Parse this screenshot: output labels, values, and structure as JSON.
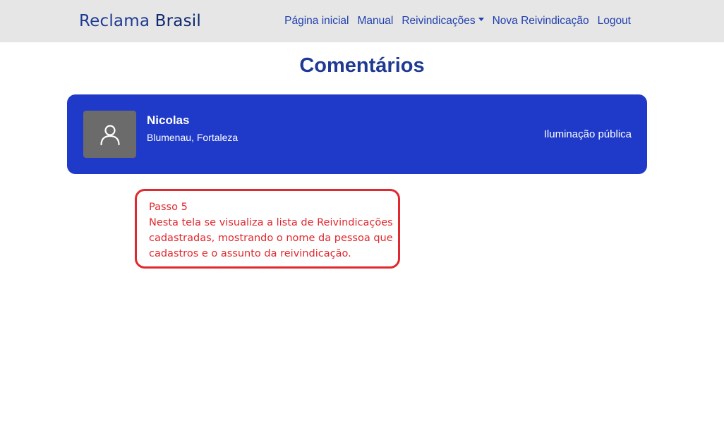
{
  "navbar": {
    "brand_part1": "Reclama",
    "brand_part2": "Brasil",
    "items": [
      {
        "label": "Página inicial"
      },
      {
        "label": "Manual"
      },
      {
        "label": "Reivindicações"
      },
      {
        "label": "Nova Reivindicação"
      },
      {
        "label": "Logout"
      }
    ]
  },
  "page": {
    "title": "Comentários"
  },
  "claims": [
    {
      "name": "Nicolas",
      "location": "Blumenau, Fortaleza",
      "subject": "Iluminação pública",
      "avatar_icon": "user-icon"
    }
  ],
  "annotation": {
    "lines": [
      "Passo 5",
      "Nesta tela se visualiza a lista de Reivindicações",
      "cadastradas, mostrando o nome da pessoa que",
      "cadastros e o assunto da reivindicação."
    ]
  },
  "colors": {
    "navbar_bg": "#e6e6e6",
    "brand": "#1f3a93",
    "nav_link": "#1f3fae",
    "card_bg": "#1f3ac8",
    "avatar_bg": "#6b6b6b",
    "annotation": "#e0282e"
  }
}
